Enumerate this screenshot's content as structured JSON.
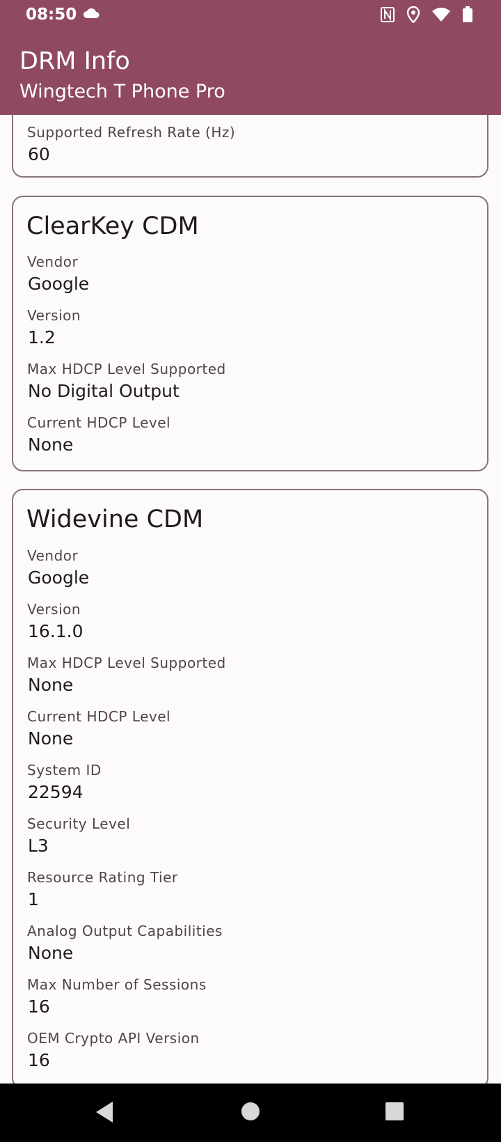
{
  "status_bar": {
    "time": "08:50",
    "icons": [
      "cloud-icon",
      "nfc-icon",
      "location-icon",
      "wifi-icon",
      "battery-icon"
    ]
  },
  "app_bar": {
    "title": "DRM Info",
    "subtitle": "Wingtech T Phone Pro",
    "color": "#8f4a61"
  },
  "display_card": {
    "fields": [
      {
        "label": "Supported Refresh Rate (Hz)",
        "value": "60"
      }
    ]
  },
  "clearkey_card": {
    "title": "ClearKey CDM",
    "fields": [
      {
        "label": "Vendor",
        "value": "Google"
      },
      {
        "label": "Version",
        "value": "1.2"
      },
      {
        "label": "Max HDCP Level Supported",
        "value": "No Digital Output"
      },
      {
        "label": "Current HDCP Level",
        "value": "None"
      }
    ]
  },
  "widevine_card": {
    "title": "Widevine CDM",
    "fields": [
      {
        "label": "Vendor",
        "value": "Google"
      },
      {
        "label": "Version",
        "value": "16.1.0"
      },
      {
        "label": "Max HDCP Level Supported",
        "value": "None"
      },
      {
        "label": "Current HDCP Level",
        "value": "None"
      },
      {
        "label": "System ID",
        "value": "22594"
      },
      {
        "label": "Security Level",
        "value": "L3"
      },
      {
        "label": "Resource Rating Tier",
        "value": "1"
      },
      {
        "label": "Analog Output Capabilities",
        "value": "None"
      },
      {
        "label": "Max Number of Sessions",
        "value": "16"
      },
      {
        "label": "OEM Crypto API Version",
        "value": "16"
      }
    ]
  },
  "nav_bar": {
    "buttons": [
      "back-icon",
      "home-icon",
      "recents-icon"
    ]
  }
}
